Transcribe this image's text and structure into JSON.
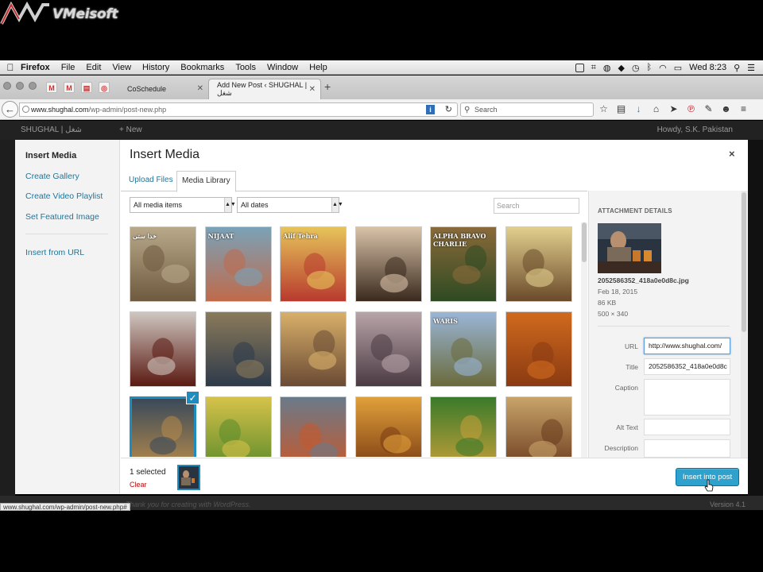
{
  "watermark": {
    "text": "VMeisoft"
  },
  "menubar": {
    "items": [
      "Firefox",
      "File",
      "Edit",
      "View",
      "History",
      "Bookmarks",
      "Tools",
      "Window",
      "Help"
    ],
    "clock": "Wed 8:23"
  },
  "browser": {
    "tabs": [
      {
        "label": "CoSchedule"
      },
      {
        "label": "Add New Post ‹ SHUGHAL | شغل"
      }
    ],
    "url_host": "www.shughal.com",
    "url_path": "/wp-admin/post-new.php",
    "search_placeholder": "Search"
  },
  "wp_admin": {
    "site": "SHUGHAL | شغل",
    "new": "+ New",
    "howdy": "Howdy, S.K. Pakistan",
    "footer_thanks": "Thank you for creating with WordPress.",
    "version": "Version 4.1",
    "status_url": "www.shughal.com/wp-admin/post-new.php#"
  },
  "modal": {
    "title": "Insert Media",
    "close": "×",
    "sidebar": [
      "Insert Media",
      "Create Gallery",
      "Create Video Playlist",
      "Set Featured Image",
      "Insert from URL"
    ],
    "tabs": [
      "Upload Files",
      "Media Library"
    ],
    "filter_type": "All media items",
    "filter_date": "All dates",
    "search_placeholder": "Search",
    "thumbnails": [
      {
        "label": "خدا ستی",
        "colors": [
          "#b9a98a",
          "#6e5a3f"
        ]
      },
      {
        "label": "NIJAAT",
        "colors": [
          "#7aa2b8",
          "#c06a4a"
        ]
      },
      {
        "label": "Alif Tehra",
        "colors": [
          "#e6c45a",
          "#b83a2e"
        ]
      },
      {
        "label": "",
        "colors": [
          "#d8c2a8",
          "#3a2a1e"
        ]
      },
      {
        "label": "ALPHA BRAVO CHARLIE",
        "colors": [
          "#8a6a3a",
          "#2e4a22"
        ]
      },
      {
        "label": "",
        "colors": [
          "#e2cf8e",
          "#6a4a2a"
        ]
      },
      {
        "label": "",
        "colors": [
          "#cfc6c0",
          "#5a1a12"
        ]
      },
      {
        "label": "",
        "colors": [
          "#8a7a5a",
          "#2e3a4a"
        ]
      },
      {
        "label": "",
        "colors": [
          "#d9b06a",
          "#6a4a34"
        ]
      },
      {
        "label": "",
        "colors": [
          "#b8a4a8",
          "#4a3a42"
        ]
      },
      {
        "label": "WARIS",
        "colors": [
          "#9ab6d8",
          "#6a6a3a"
        ]
      },
      {
        "label": "",
        "colors": [
          "#d06a1e",
          "#8a3a12"
        ]
      },
      {
        "label": "",
        "colors": [
          "#3a4a5a",
          "#b88a4a"
        ]
      },
      {
        "label": "",
        "colors": [
          "#d6c24a",
          "#5a8a2a"
        ]
      },
      {
        "label": "",
        "colors": [
          "#6a7a8a",
          "#c8582a"
        ]
      },
      {
        "label": "",
        "colors": [
          "#e0a03a",
          "#7a3a12"
        ]
      },
      {
        "label": "",
        "colors": [
          "#3a7a2a",
          "#c8a03a"
        ]
      },
      {
        "label": "",
        "colors": [
          "#c8a46a",
          "#6a3a1e"
        ]
      }
    ],
    "selected_index": 12,
    "details": {
      "heading": "ATTACHMENT DETAILS",
      "filename": "2052586352_418a0e0d8c.jpg",
      "date": "Feb 18, 2015",
      "size": "86 KB",
      "dimensions": "500 × 340",
      "fields": [
        {
          "label": "URL",
          "value": "http://www.shughal.com/​"
        },
        {
          "label": "Title",
          "value": "2052586352_418a0e0d8c"
        },
        {
          "label": "Caption",
          "value": ""
        },
        {
          "label": "Alt Text",
          "value": ""
        },
        {
          "label": "Description",
          "value": ""
        }
      ]
    },
    "toolbar": {
      "selected": "1 selected",
      "clear": "Clear",
      "insert": "Insert into post"
    }
  }
}
